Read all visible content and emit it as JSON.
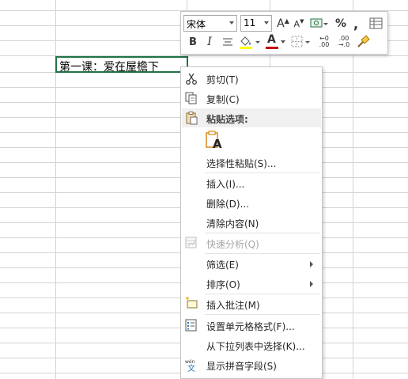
{
  "sheet": {
    "active_cell_text": "第一课：爱在屋檐下"
  },
  "mini_toolbar": {
    "font_name": "宋体",
    "font_size": "11",
    "increase_font_label": "A",
    "decrease_font_label": "A",
    "percent_label": "%",
    "comma_label": ",",
    "bold_label": "B",
    "italic_label": "I",
    "font_color_label": "A",
    "font_color": "#c00000",
    "fill_color": "#ffff00",
    "inc_decimal_label": ".00",
    "dec_decimal_label": ".00"
  },
  "context_menu": {
    "items": [
      {
        "label": "剪切(T)",
        "icon": "scissors-icon"
      },
      {
        "label": "复制(C)",
        "icon": "copy-icon"
      },
      {
        "label": "粘贴选项:",
        "icon": "paste-icon"
      },
      {
        "label": "选择性粘贴(S)..."
      },
      {
        "label": "插入(I)..."
      },
      {
        "label": "删除(D)..."
      },
      {
        "label": "清除内容(N)"
      },
      {
        "label": "快速分析(Q)",
        "icon": "quick-analysis-icon",
        "disabled": true
      },
      {
        "label": "筛选(E)",
        "submenu": true
      },
      {
        "label": "排序(O)",
        "submenu": true
      },
      {
        "label": "插入批注(M)",
        "icon": "insert-comment-icon"
      },
      {
        "label": "设置单元格格式(F)...",
        "icon": "format-cells-icon"
      },
      {
        "label": "从下拉列表中选择(K)..."
      },
      {
        "label": "显示拼音字段(S)",
        "icon": "phonetic-icon"
      }
    ],
    "paste_button_label": "A"
  }
}
